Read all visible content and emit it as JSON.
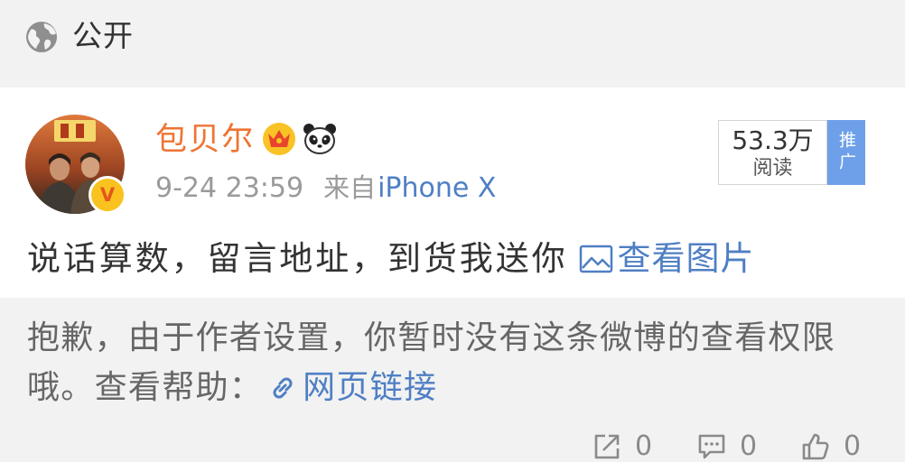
{
  "visibility": {
    "icon": "globe-icon",
    "label": "公开"
  },
  "post": {
    "author": {
      "name": "包贝尔",
      "verified_badge": "V",
      "badge_icons": [
        "crown-icon",
        "panda-icon"
      ]
    },
    "time": "9-24 23:59",
    "source_prefix": "来自",
    "source": "iPhone X",
    "reads": {
      "count": "53.3万",
      "label": "阅读"
    },
    "promo_tag": "推广",
    "text": "说话算数，留言地址，到货我送你",
    "image_link": {
      "icon": "image-icon",
      "label": "查看图片"
    }
  },
  "notice": {
    "line1": "抱歉，由于作者设置，你暂时没有这条微博的查看权限",
    "line2_prefix": "哦。查看帮助：",
    "link": {
      "icon": "link-icon",
      "label": "网页链接"
    }
  },
  "actions": [
    {
      "icon": "share-icon",
      "count": "0"
    },
    {
      "icon": "comment-icon",
      "count": "0"
    },
    {
      "icon": "like-icon",
      "count": "0"
    }
  ],
  "colors": {
    "author_name": "#ee7433",
    "link": "#4f7fc4",
    "promo_tag": "#6ea0ea",
    "muted_text": "#8a8a8a",
    "background": "#f2f2f2"
  }
}
